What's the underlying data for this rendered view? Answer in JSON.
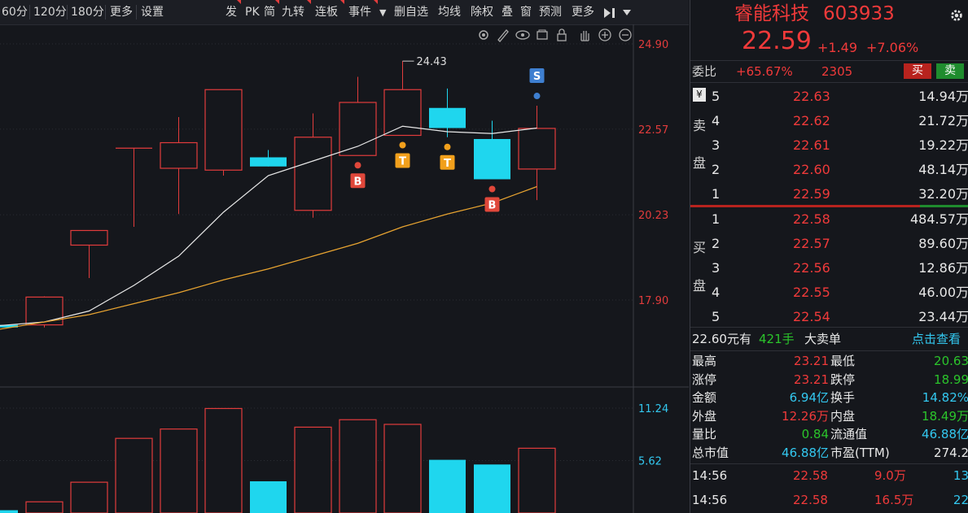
{
  "toolbar": {
    "left_items": [
      "60分",
      "120分",
      "180分",
      "更多",
      "设置"
    ],
    "right_items": [
      "发",
      "PK",
      "简",
      "九转",
      "连板",
      "事件",
      "▼",
      "删自选",
      "均线",
      "除权",
      "叠",
      "窗",
      "预测",
      "更多"
    ]
  },
  "chart_data": {
    "type": "candlestick",
    "price_axis": [
      "24.90",
      "22.57",
      "20.23",
      "17.90"
    ],
    "volume_axis": [
      "11.24",
      "5.62"
    ],
    "high_label": "24.43",
    "candles": [
      {
        "o": 17.22,
        "c": 17.15,
        "h": 17.38,
        "l": 16.95,
        "up": false
      },
      {
        "o": 17.22,
        "c": 17.98,
        "h": 18.0,
        "l": 17.15,
        "up": true
      },
      {
        "o": 19.4,
        "c": 19.8,
        "h": 19.78,
        "l": 18.5,
        "up": true
      },
      {
        "o": null,
        "c": null,
        "h": 22.05,
        "l": 19.9,
        "up": true
      },
      {
        "o": 21.5,
        "c": 22.2,
        "h": 22.9,
        "l": 20.25,
        "up": true
      },
      {
        "o": 21.45,
        "c": 23.65,
        "h": 23.65,
        "l": 21.3,
        "up": true
      },
      {
        "o": 21.8,
        "c": 21.55,
        "h": 22.0,
        "l": 21.55,
        "up": false
      },
      {
        "o": 20.35,
        "c": 22.35,
        "h": 23.0,
        "l": 20.15,
        "up": true
      },
      {
        "o": 21.85,
        "c": 23.3,
        "h": 24.0,
        "l": 21.85,
        "up": true
      },
      {
        "o": 22.4,
        "c": 23.65,
        "h": 24.43,
        "l": 22.4,
        "up": true
      },
      {
        "o": 23.15,
        "c": 22.6,
        "h": 23.68,
        "l": 22.35,
        "up": false
      },
      {
        "o": 22.3,
        "c": 21.2,
        "h": 22.8,
        "l": 21.2,
        "up": false
      },
      {
        "o": 21.48,
        "c": 22.59,
        "h": 23.21,
        "l": 20.63,
        "up": true
      }
    ],
    "volumes": [
      0.3,
      1.2,
      3.3,
      8.0,
      9.0,
      11.2,
      3.4,
      9.2,
      10.0,
      9.5,
      5.7,
      5.2,
      6.94
    ],
    "volume_up": [
      false,
      true,
      true,
      true,
      true,
      true,
      false,
      true,
      true,
      true,
      false,
      false,
      true
    ],
    "markers": [
      {
        "i": 8,
        "label": "B",
        "color": "#e0473a"
      },
      {
        "i": 9,
        "label": "T",
        "color": "#f2a01c"
      },
      {
        "i": 10,
        "label": "T",
        "color": "#f2a01c"
      },
      {
        "i": 11,
        "label": "B",
        "color": "#e0473a"
      },
      {
        "i": 12,
        "label": "S",
        "color": "#3e7fd0"
      }
    ]
  },
  "panel": {
    "stock_name": "睿能科技",
    "stock_code": "603933",
    "price": "22.59",
    "change": "+1.49",
    "change_pct": "+7.06%",
    "weibi_label": "委比",
    "weibi_value": "+65.67%",
    "weicha_value": "2305",
    "buy_button": "买",
    "sell_button": "卖",
    "yen_icon": "¥",
    "sell_side_label": [
      "卖",
      "盘"
    ],
    "buy_side_label": [
      "买",
      "盘"
    ],
    "asks": [
      {
        "n": "5",
        "price": "22.63",
        "vol": "14.94万"
      },
      {
        "n": "4",
        "price": "22.62",
        "vol": "21.72万"
      },
      {
        "n": "3",
        "price": "22.61",
        "vol": "19.22万"
      },
      {
        "n": "2",
        "price": "22.60",
        "vol": "48.14万"
      },
      {
        "n": "1",
        "price": "22.59",
        "vol": "32.20万"
      }
    ],
    "bids": [
      {
        "n": "1",
        "price": "22.58",
        "vol": "484.57万"
      },
      {
        "n": "2",
        "price": "22.57",
        "vol": "89.60万"
      },
      {
        "n": "3",
        "price": "22.56",
        "vol": "12.86万"
      },
      {
        "n": "4",
        "price": "22.55",
        "vol": "46.00万"
      },
      {
        "n": "5",
        "price": "22.54",
        "vol": "23.44万"
      }
    ],
    "big_order": {
      "price": "22.60元有",
      "hands": "421手",
      "label": "大卖单",
      "link": "点击查看"
    },
    "stats": [
      {
        "l1": "最高",
        "v1": "23.21",
        "c1": "red",
        "l2": "最低",
        "v2": "20.63",
        "c2": "green"
      },
      {
        "l1": "涨停",
        "v1": "23.21",
        "c1": "red",
        "l2": "跌停",
        "v2": "18.99",
        "c2": "green"
      },
      {
        "l1": "金额",
        "v1": "6.94亿",
        "c1": "cyan",
        "l2": "换手",
        "v2": "14.82%",
        "c2": "cyan"
      },
      {
        "l1": "外盘",
        "v1": "12.26万",
        "c1": "red",
        "l2": "内盘",
        "v2": "18.49万",
        "c2": "green"
      },
      {
        "l1": "量比",
        "v1": "0.84",
        "c1": "green",
        "l2": "流通值",
        "v2": "46.88亿",
        "c2": "cyan"
      },
      {
        "l1": "总市值",
        "v1": "46.88亿",
        "c1": "cyan",
        "l2": "市盈(TTM)",
        "v2": "274.2",
        "c2": "white"
      }
    ],
    "ticks": [
      {
        "time": "14:56",
        "price": "22.58",
        "vol": "9.0万",
        "n": "13"
      },
      {
        "time": "14:56",
        "price": "22.58",
        "vol": "16.5万",
        "n": "22"
      }
    ]
  }
}
